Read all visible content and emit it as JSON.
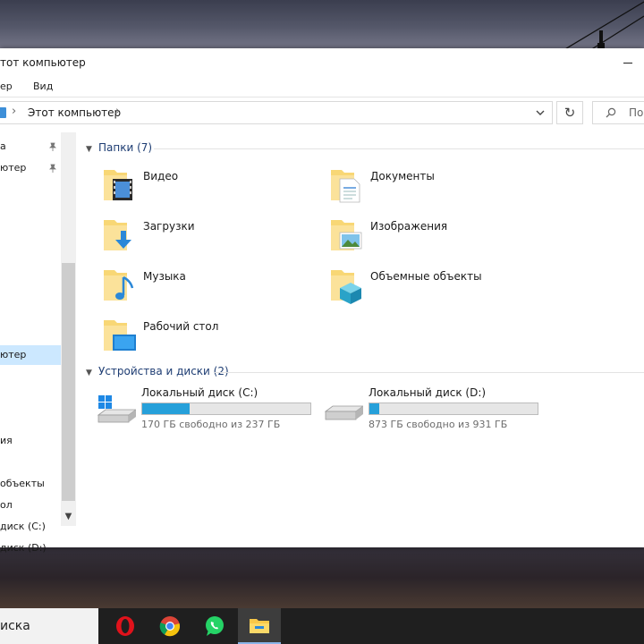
{
  "window": {
    "title": "тот компьютер",
    "ribbon_tabs": [
      "ер",
      "Вид"
    ]
  },
  "address": {
    "path": "Этот компьютер",
    "search_placeholder": "По"
  },
  "nav": {
    "items": [
      {
        "label": "а",
        "pinned": true
      },
      {
        "label": "ютер",
        "pinned": true
      },
      {
        "label": "ютер",
        "selected": true
      },
      {
        "label": "ия"
      },
      {
        "label": "объекты"
      },
      {
        "label": "ол"
      },
      {
        "label": "диск (C:)"
      },
      {
        "label": "диск (D:)"
      }
    ]
  },
  "folders_section": {
    "title": "Папки (7)",
    "items": [
      {
        "label": "Видео",
        "icon": "video-folder-icon"
      },
      {
        "label": "Документы",
        "icon": "documents-folder-icon"
      },
      {
        "label": "Загрузки",
        "icon": "downloads-folder-icon"
      },
      {
        "label": "Изображения",
        "icon": "pictures-folder-icon"
      },
      {
        "label": "Музыка",
        "icon": "music-folder-icon"
      },
      {
        "label": "Объемные объекты",
        "icon": "3d-objects-folder-icon"
      },
      {
        "label": "Рабочий стол",
        "icon": "desktop-folder-icon"
      }
    ]
  },
  "drives_section": {
    "title": "Устройства и диски (2)",
    "items": [
      {
        "name": "Локальный диск (C:)",
        "free_text": "170 ГБ свободно из 237 ГБ",
        "used_fraction": 0.28,
        "icon": "windows-drive-icon"
      },
      {
        "name": "Локальный диск (D:)",
        "free_text": "873 ГБ свободно из 931 ГБ",
        "used_fraction": 0.06,
        "icon": "hard-drive-icon"
      }
    ]
  },
  "taskbar": {
    "search_text": "иска",
    "apps": [
      "opera-icon",
      "chrome-icon",
      "whatsapp-icon",
      "file-explorer-icon"
    ]
  },
  "colors": {
    "accent": "#26a0da",
    "selection": "#cce8ff",
    "section_header": "#1e3d73"
  }
}
